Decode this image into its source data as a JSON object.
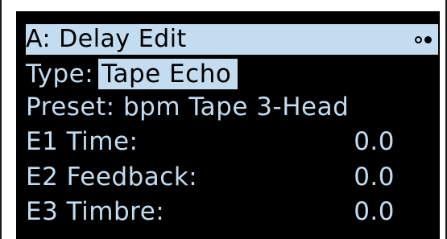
{
  "header": {
    "title": "A: Delay Edit",
    "page_indicator_icon": "page-dots-icon"
  },
  "type": {
    "label": "Type:",
    "value": "Tape Echo"
  },
  "preset": {
    "label": "Preset:",
    "value": "bpm Tape 3-Head"
  },
  "params": [
    {
      "label": "E1  Time:",
      "value": "0.0"
    },
    {
      "label": "E2  Feedback:",
      "value": "0.0"
    },
    {
      "label": "E3  Timbre:",
      "value": "0.0"
    }
  ],
  "colors": {
    "screen_bg": "#000000",
    "text": "#c4dcf0",
    "highlight": "#c4dcf0"
  }
}
